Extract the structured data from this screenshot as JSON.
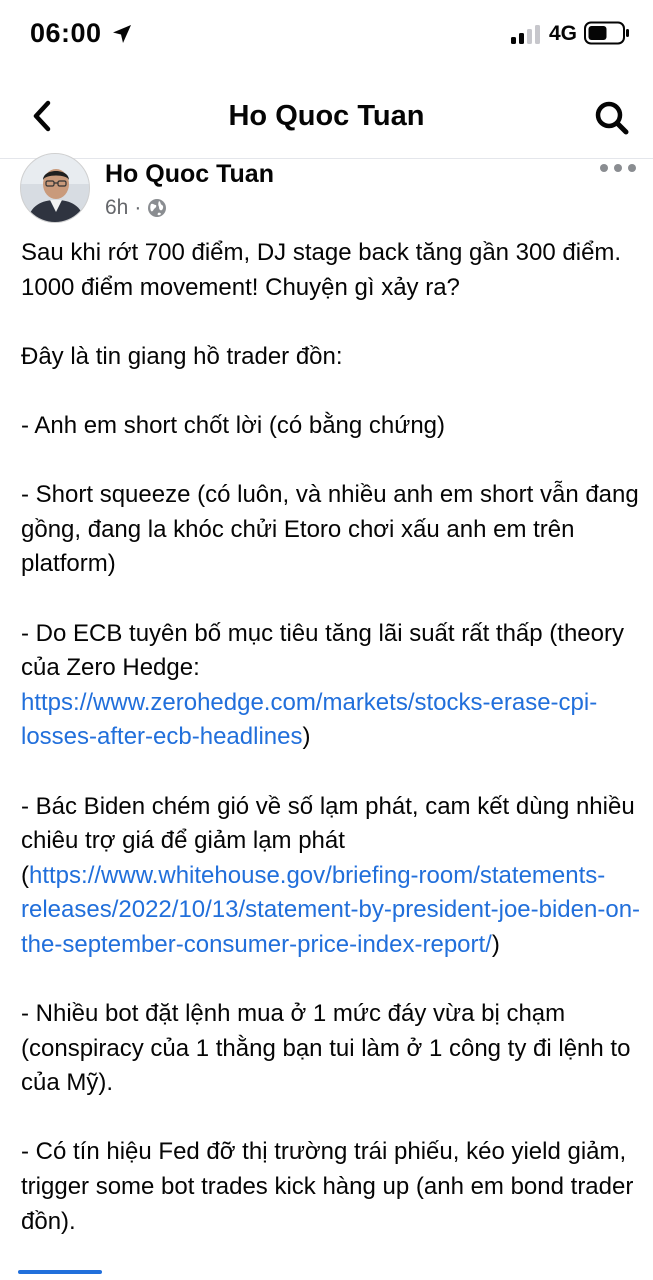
{
  "status_bar": {
    "time": "06:00",
    "network": "4G"
  },
  "nav": {
    "title": "Ho Quoc Tuan",
    "back_icon": "chevron-left-icon",
    "search_icon": "search-icon"
  },
  "post": {
    "author": "Ho Quoc Tuan",
    "time_ago": "6h",
    "separator": "·",
    "privacy_icon": "globe-icon",
    "more_icon": "more-horizontal-icon",
    "body": {
      "p1": "Sau khi rớt 700 điểm, DJ stage back tăng gần 300 điểm. 1000 điểm movement! Chuyện gì xảy ra?",
      "p2": "Đây là tin giang hồ trader đồn:",
      "p3": "- Anh em short chốt lời (có bằng chứng)",
      "p4": "- Short squeeze (có luôn, và nhiều anh em short vẫn đang gồng, đang la khóc chửi Etoro chơi xấu anh em trên platform)",
      "p5_text": "- Do ECB tuyên bố mục tiêu tăng lãi suất rất thấp (theory của Zero Hedge: ",
      "p5_link": "https://www.zerohedge.com/markets/stocks-erase-cpi-losses-after-ecb-headlines",
      "p5_end": ")",
      "p6_text": "- Bác Biden chém gió về số lạm phát, cam kết dùng nhiều chiêu trợ giá để giảm lạm phát (",
      "p6_link": "https://www.whitehouse.gov/briefing-room/statements-releases/2022/10/13/statement-by-president-joe-biden-on-the-september-consumer-price-index-report/",
      "p6_end": ")",
      "p7": "- Nhiều bot đặt lệnh mua ở 1 mức đáy vừa bị chạm (conspiracy của 1 thằng bạn tui làm ở 1 công ty đi lệnh to của Mỹ).",
      "p8": "- Có tín hiệu Fed đỡ thị trường trái phiếu, kéo yield giảm, trigger some bot trades kick hàng up (anh em bond trader đồn)."
    }
  },
  "colors": {
    "link": "#216fdb",
    "meta": "#65676b",
    "text": "#050505"
  }
}
